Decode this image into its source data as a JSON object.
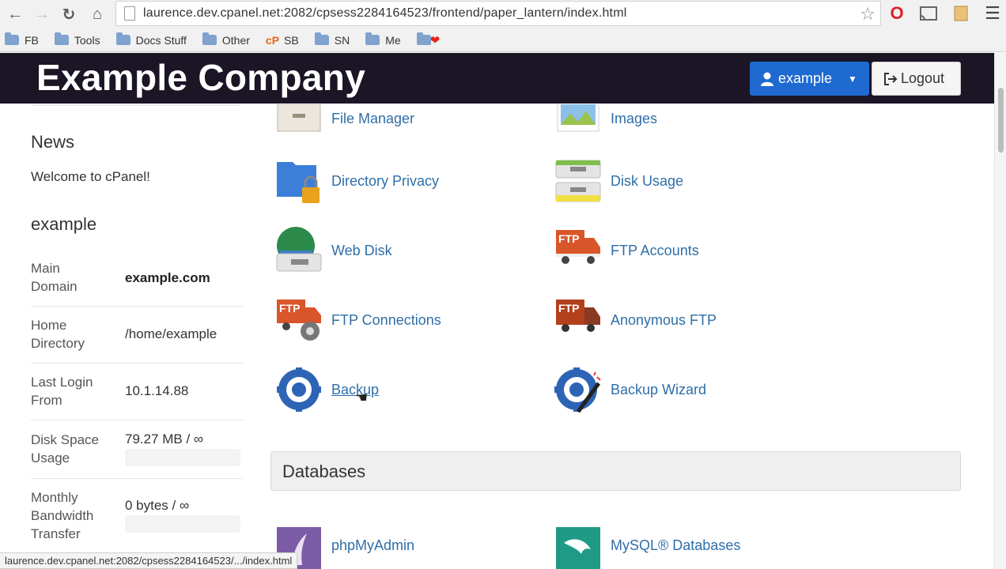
{
  "browser": {
    "url": "laurence.dev.cpanel.net:2082/cpsess2284164523/frontend/paper_lantern/index.html",
    "bookmarks": [
      "FB",
      "Tools",
      "Docs Stuff",
      "Other",
      "SB",
      "SN",
      "Me"
    ],
    "status_url": "laurence.dev.cpanel.net:2082/cpsess2284164523/.../index.html"
  },
  "header": {
    "company": "Example Company",
    "user_label": "example",
    "logout_label": "Logout"
  },
  "sidebar": {
    "news_heading": "News",
    "news_text": "Welcome to cPanel!",
    "account_heading": "example",
    "stats": [
      {
        "label": "Main Domain",
        "value": "example.com"
      },
      {
        "label": "Home Directory",
        "value": "/home/example"
      },
      {
        "label": "Last Login From",
        "value": "10.1.14.88"
      },
      {
        "label": "Disk Space Usage",
        "value": "79.27 MB / ∞"
      },
      {
        "label": "Monthly Bandwidth Transfer",
        "value": "0 bytes / ∞"
      }
    ]
  },
  "features": {
    "file_manager": "File Manager",
    "images": "Images",
    "directory_privacy": "Directory Privacy",
    "disk_usage": "Disk Usage",
    "web_disk": "Web Disk",
    "ftp_accounts": "FTP Accounts",
    "ftp_connections": "FTP Connections",
    "anonymous_ftp": "Anonymous FTP",
    "backup": "Backup",
    "backup_wizard": "Backup Wizard",
    "ftp_badge": "FTP"
  },
  "databases": {
    "section_title": "Databases",
    "phpmyadmin": "phpMyAdmin",
    "mysql": "MySQL® Databases"
  },
  "colors": {
    "header_bg": "#1b1526",
    "primary_button": "#1f6ad0",
    "link": "#2f6ea8"
  }
}
